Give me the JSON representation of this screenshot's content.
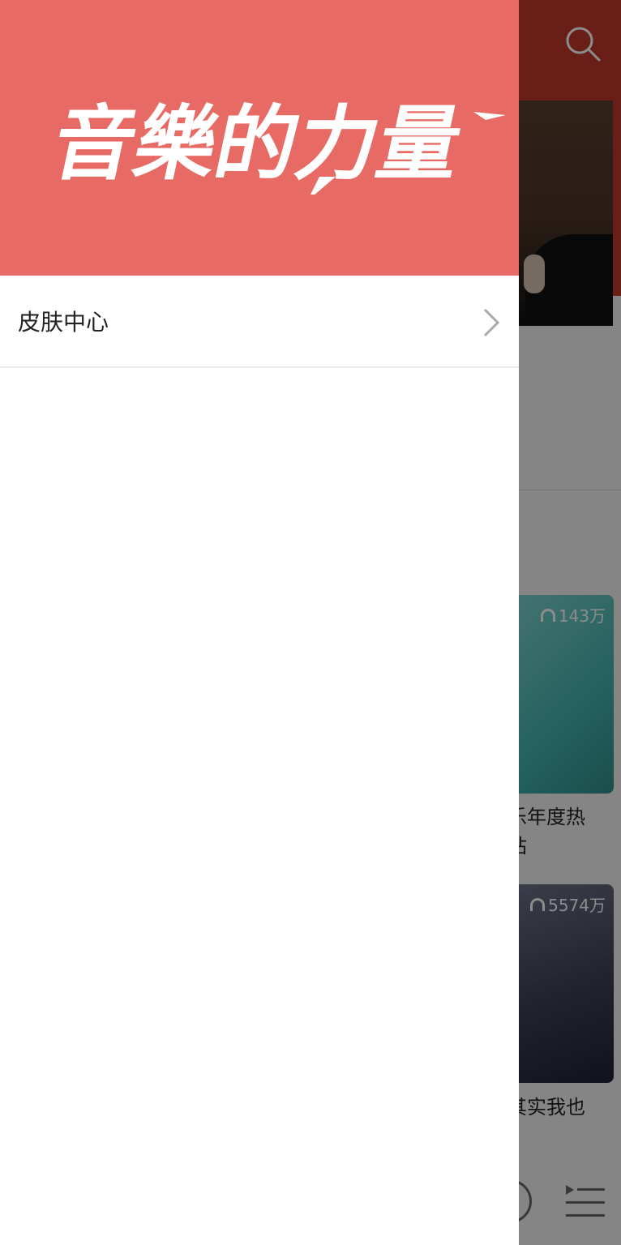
{
  "background": {
    "search_icon": "search-icon",
    "cards": [
      {
        "play_count": "143万",
        "title_fragment": "乐年度热\n站"
      },
      {
        "play_count": "5574万",
        "title_fragment": "其实我也"
      }
    ]
  },
  "drawer": {
    "hero_title": "音樂的力量",
    "items": [
      {
        "label": "皮肤中心",
        "icon": "chevron-right-icon"
      }
    ]
  },
  "colors": {
    "hero": "#e86a64",
    "header": "#c0392b",
    "overlay": "rgba(0,0,0,0.45)"
  }
}
